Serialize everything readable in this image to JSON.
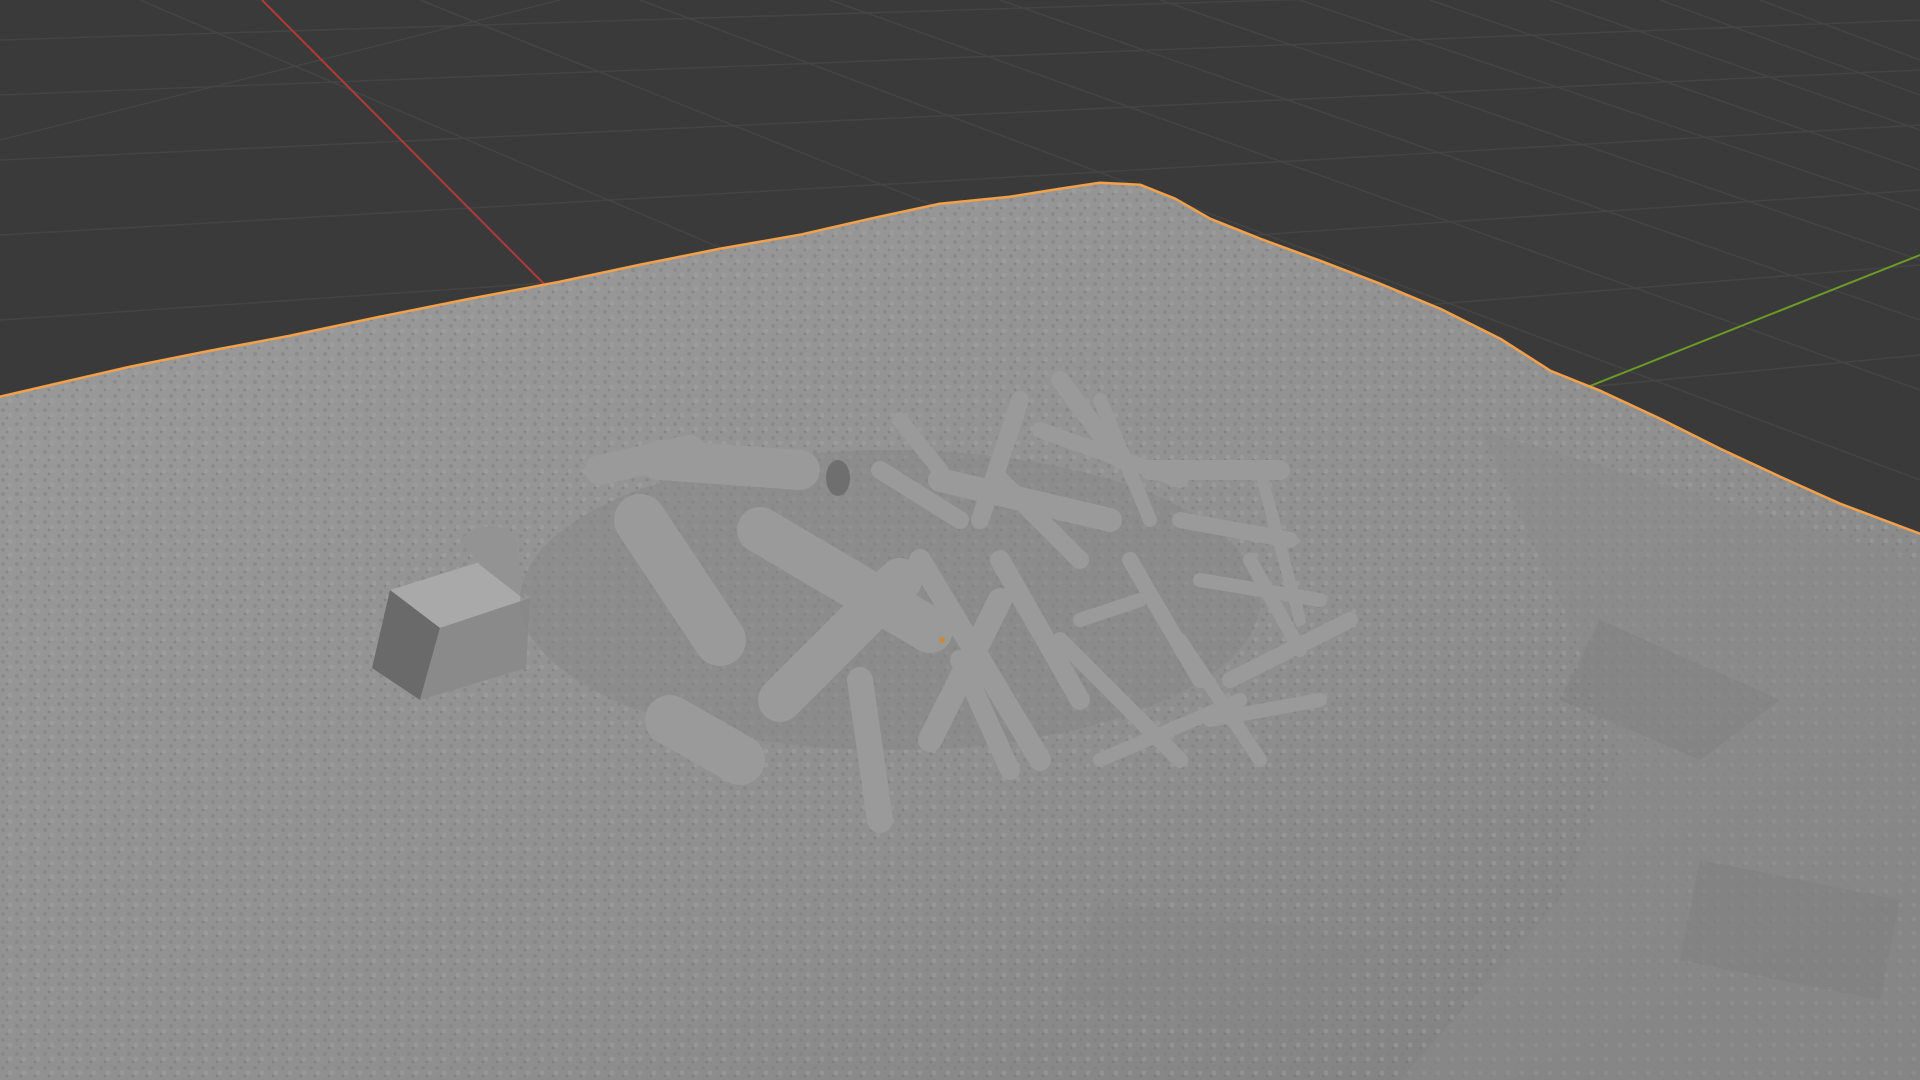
{
  "viewport": {
    "background_color": "#3a3a3a",
    "grid_color": "#444444",
    "x_axis_color": "#b03a3a",
    "y_axis_color": "#6a9a28",
    "selection_outline_color": "#f2a04a"
  },
  "scene": {
    "selected_object": {
      "icon": "terrain-scan-mesh",
      "shading": "solid",
      "fill_color": "#8e8e8e",
      "highlight_color": "#a9a9a9",
      "shadow_color": "#6a6a6a"
    },
    "log_pile": {
      "icon": "woodpile-mesh",
      "fill_color": "#9a9a9a"
    },
    "stump_block": {
      "icon": "stump-mesh",
      "fill_color": "#8a8a8a"
    }
  }
}
